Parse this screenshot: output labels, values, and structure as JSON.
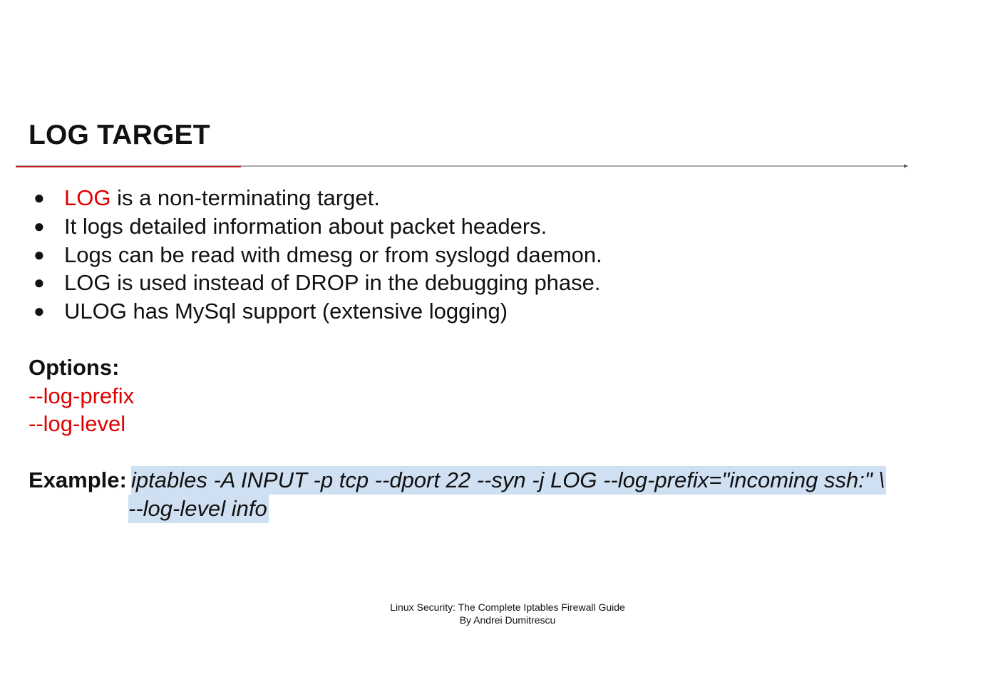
{
  "slide": {
    "title": "LOG TARGET"
  },
  "bullets": [
    {
      "highlight": "LOG",
      "text": " is a non-terminating target."
    },
    {
      "highlight": "",
      "text": "It logs detailed information about packet headers."
    },
    {
      "highlight": "",
      "text": "Logs can be read with dmesg or from syslogd daemon."
    },
    {
      "highlight": "",
      "text": "LOG is used instead of DROP in the debugging phase."
    },
    {
      "highlight": "",
      "text": "ULOG has MySql support (extensive logging)"
    }
  ],
  "bullet_symbol": "●",
  "options": {
    "heading": "Options:",
    "items": [
      "--log-prefix",
      "--log-level"
    ]
  },
  "example": {
    "label": "Example:",
    "line1": "iptables -A INPUT -p tcp --dport 22 --syn -j LOG --log-prefix=\"incoming ssh:\" \\",
    "line2": "--log-level info"
  },
  "footer": {
    "line1": "Linux Security: The Complete Iptables Firewall Guide",
    "line2": "By Andrei Dumitrescu"
  },
  "colors": {
    "accent_red": "#e00000",
    "code_highlight": "#cfe0f2",
    "text": "#111111"
  }
}
